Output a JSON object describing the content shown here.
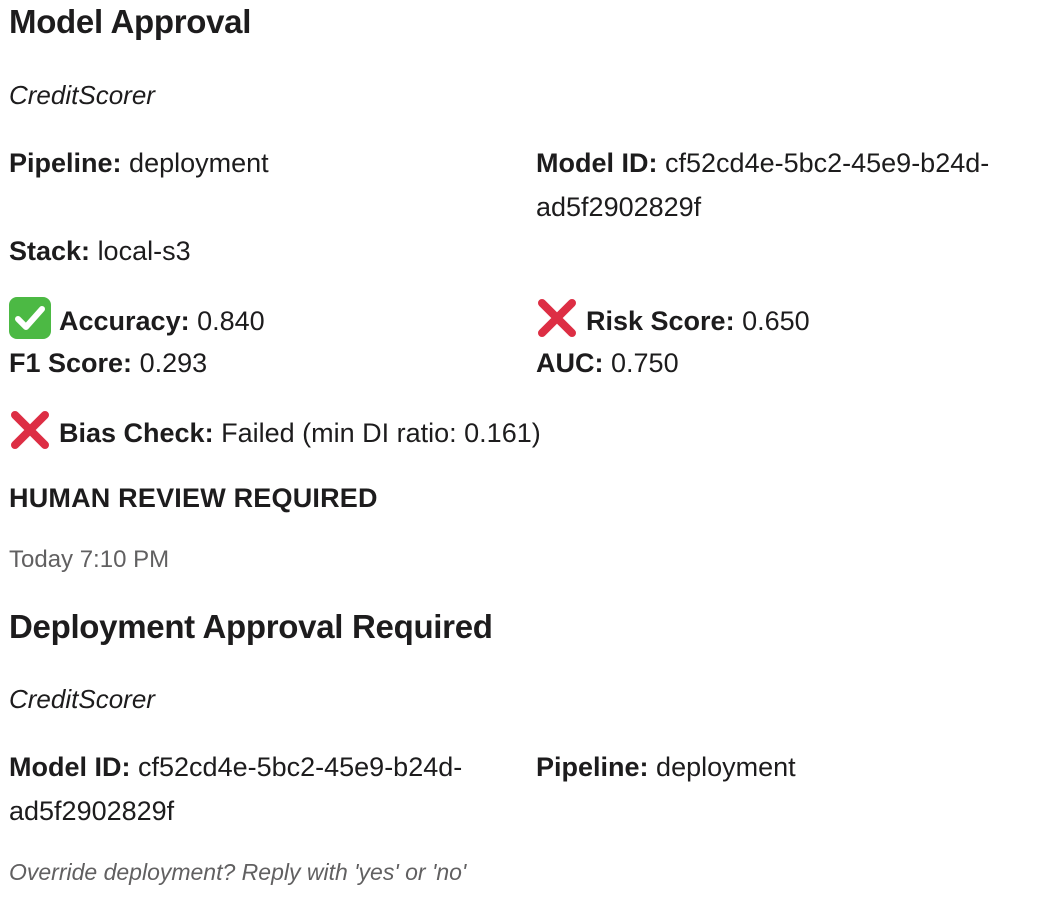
{
  "message1": {
    "title": "Model Approval",
    "model_name": "CreditScorer",
    "pipeline_label": "Pipeline:",
    "pipeline_value": "deployment",
    "model_id_label": "Model ID:",
    "model_id_value": "cf52cd4e-5bc2-45e9-b24d-ad5f2902829f",
    "stack_label": "Stack:",
    "stack_value": "local-s3",
    "accuracy_label": "Accuracy:",
    "accuracy_value": "0.840",
    "accuracy_icon": "check-mark-button-icon",
    "risk_label": "Risk Score:",
    "risk_value": "0.650",
    "risk_icon": "cross-mark-icon",
    "f1_label": "F1 Score:",
    "f1_value": "0.293",
    "auc_label": "AUC:",
    "auc_value": "0.750",
    "bias_label": "Bias Check:",
    "bias_value": "Failed (min DI ratio: 0.161)",
    "bias_icon": "cross-mark-icon",
    "review_text": "HUMAN REVIEW REQUIRED"
  },
  "timestamp": "Today 7:10 PM",
  "message2": {
    "title": "Deployment Approval Required",
    "model_name": "CreditScorer",
    "model_id_label": "Model ID:",
    "model_id_value": "cf52cd4e-5bc2-45e9-b24d-ad5f2902829f",
    "pipeline_label": "Pipeline:",
    "pipeline_value": "deployment",
    "note": "Override deployment? Reply with 'yes' or 'no'"
  },
  "colors": {
    "text": "#1d1c1d",
    "muted": "#616061",
    "check_green": "#4cb944",
    "cross_red": "#dd2e44"
  }
}
